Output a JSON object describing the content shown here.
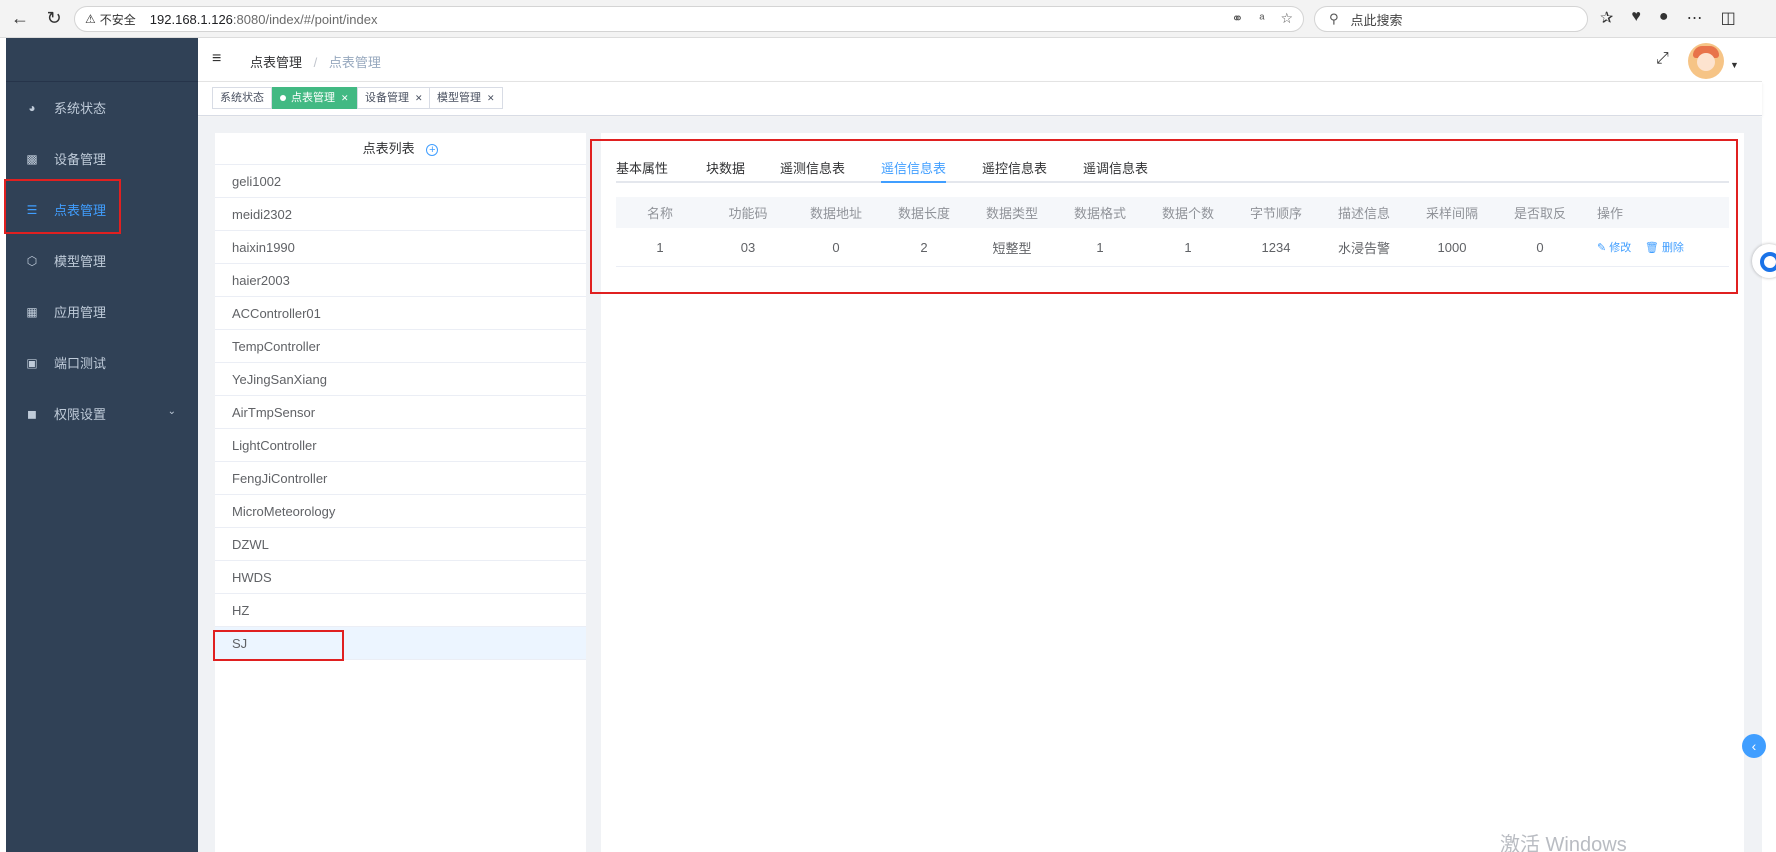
{
  "browser": {
    "back_icon": "arrow-left-icon",
    "reload_icon": "reload-icon",
    "insecure_label": "不安全",
    "url_host": "192.168.1.126",
    "url_rest": ":8080/index/#/point/index",
    "search_placeholder": "点此搜索"
  },
  "sidebar": {
    "items": [
      {
        "label": "系统状态",
        "icon": "dashboard-icon"
      },
      {
        "label": "设备管理",
        "icon": "sitemap-icon"
      },
      {
        "label": "点表管理",
        "icon": "list-icon",
        "active": true
      },
      {
        "label": "模型管理",
        "icon": "cube-icon"
      },
      {
        "label": "应用管理",
        "icon": "apps-icon"
      },
      {
        "label": "端口测试",
        "icon": "port-icon"
      },
      {
        "label": "权限设置",
        "icon": "lock-icon",
        "expandable": true
      }
    ]
  },
  "header": {
    "breadcrumb": [
      "点表管理",
      "点表管理"
    ]
  },
  "tags": [
    {
      "label": "系统状态",
      "active": false,
      "closable": false
    },
    {
      "label": "点表管理",
      "active": true,
      "closable": true
    },
    {
      "label": "设备管理",
      "active": false,
      "closable": true
    },
    {
      "label": "模型管理",
      "active": false,
      "closable": true
    }
  ],
  "point_list": {
    "title": "点表列表",
    "items": [
      "geli1002",
      "meidi2302",
      "haixin1990",
      "haier2003",
      "ACController01",
      "TempController",
      "YeJingSanXiang",
      "AirTmpSensor",
      "LightController",
      "FengJiController",
      "MicroMeteorology",
      "DZWL",
      "HWDS",
      "HZ",
      "SJ"
    ],
    "selected": "SJ"
  },
  "detail": {
    "tabs": [
      "基本属性",
      "块数据",
      "遥测信息表",
      "遥信信息表",
      "遥控信息表",
      "遥调信息表"
    ],
    "active_tab": "遥信信息表",
    "table": {
      "columns": [
        "名称",
        "功能码",
        "数据地址",
        "数据长度",
        "数据类型",
        "数据格式",
        "数据个数",
        "字节顺序",
        "描述信息",
        "采样间隔",
        "是否取反",
        "操作"
      ],
      "rows": [
        [
          "1",
          "03",
          "0",
          "2",
          "短整型",
          "1",
          "1",
          "1234",
          "水浸告警",
          "1000",
          "0"
        ]
      ],
      "edit_label": "修改",
      "delete_label": "删除"
    }
  },
  "watermark": "激活 Windows",
  "colors": {
    "sidebar_bg": "#304156",
    "accent": "#409eff",
    "tag_active": "#42b983",
    "annotation": "#e02020"
  }
}
